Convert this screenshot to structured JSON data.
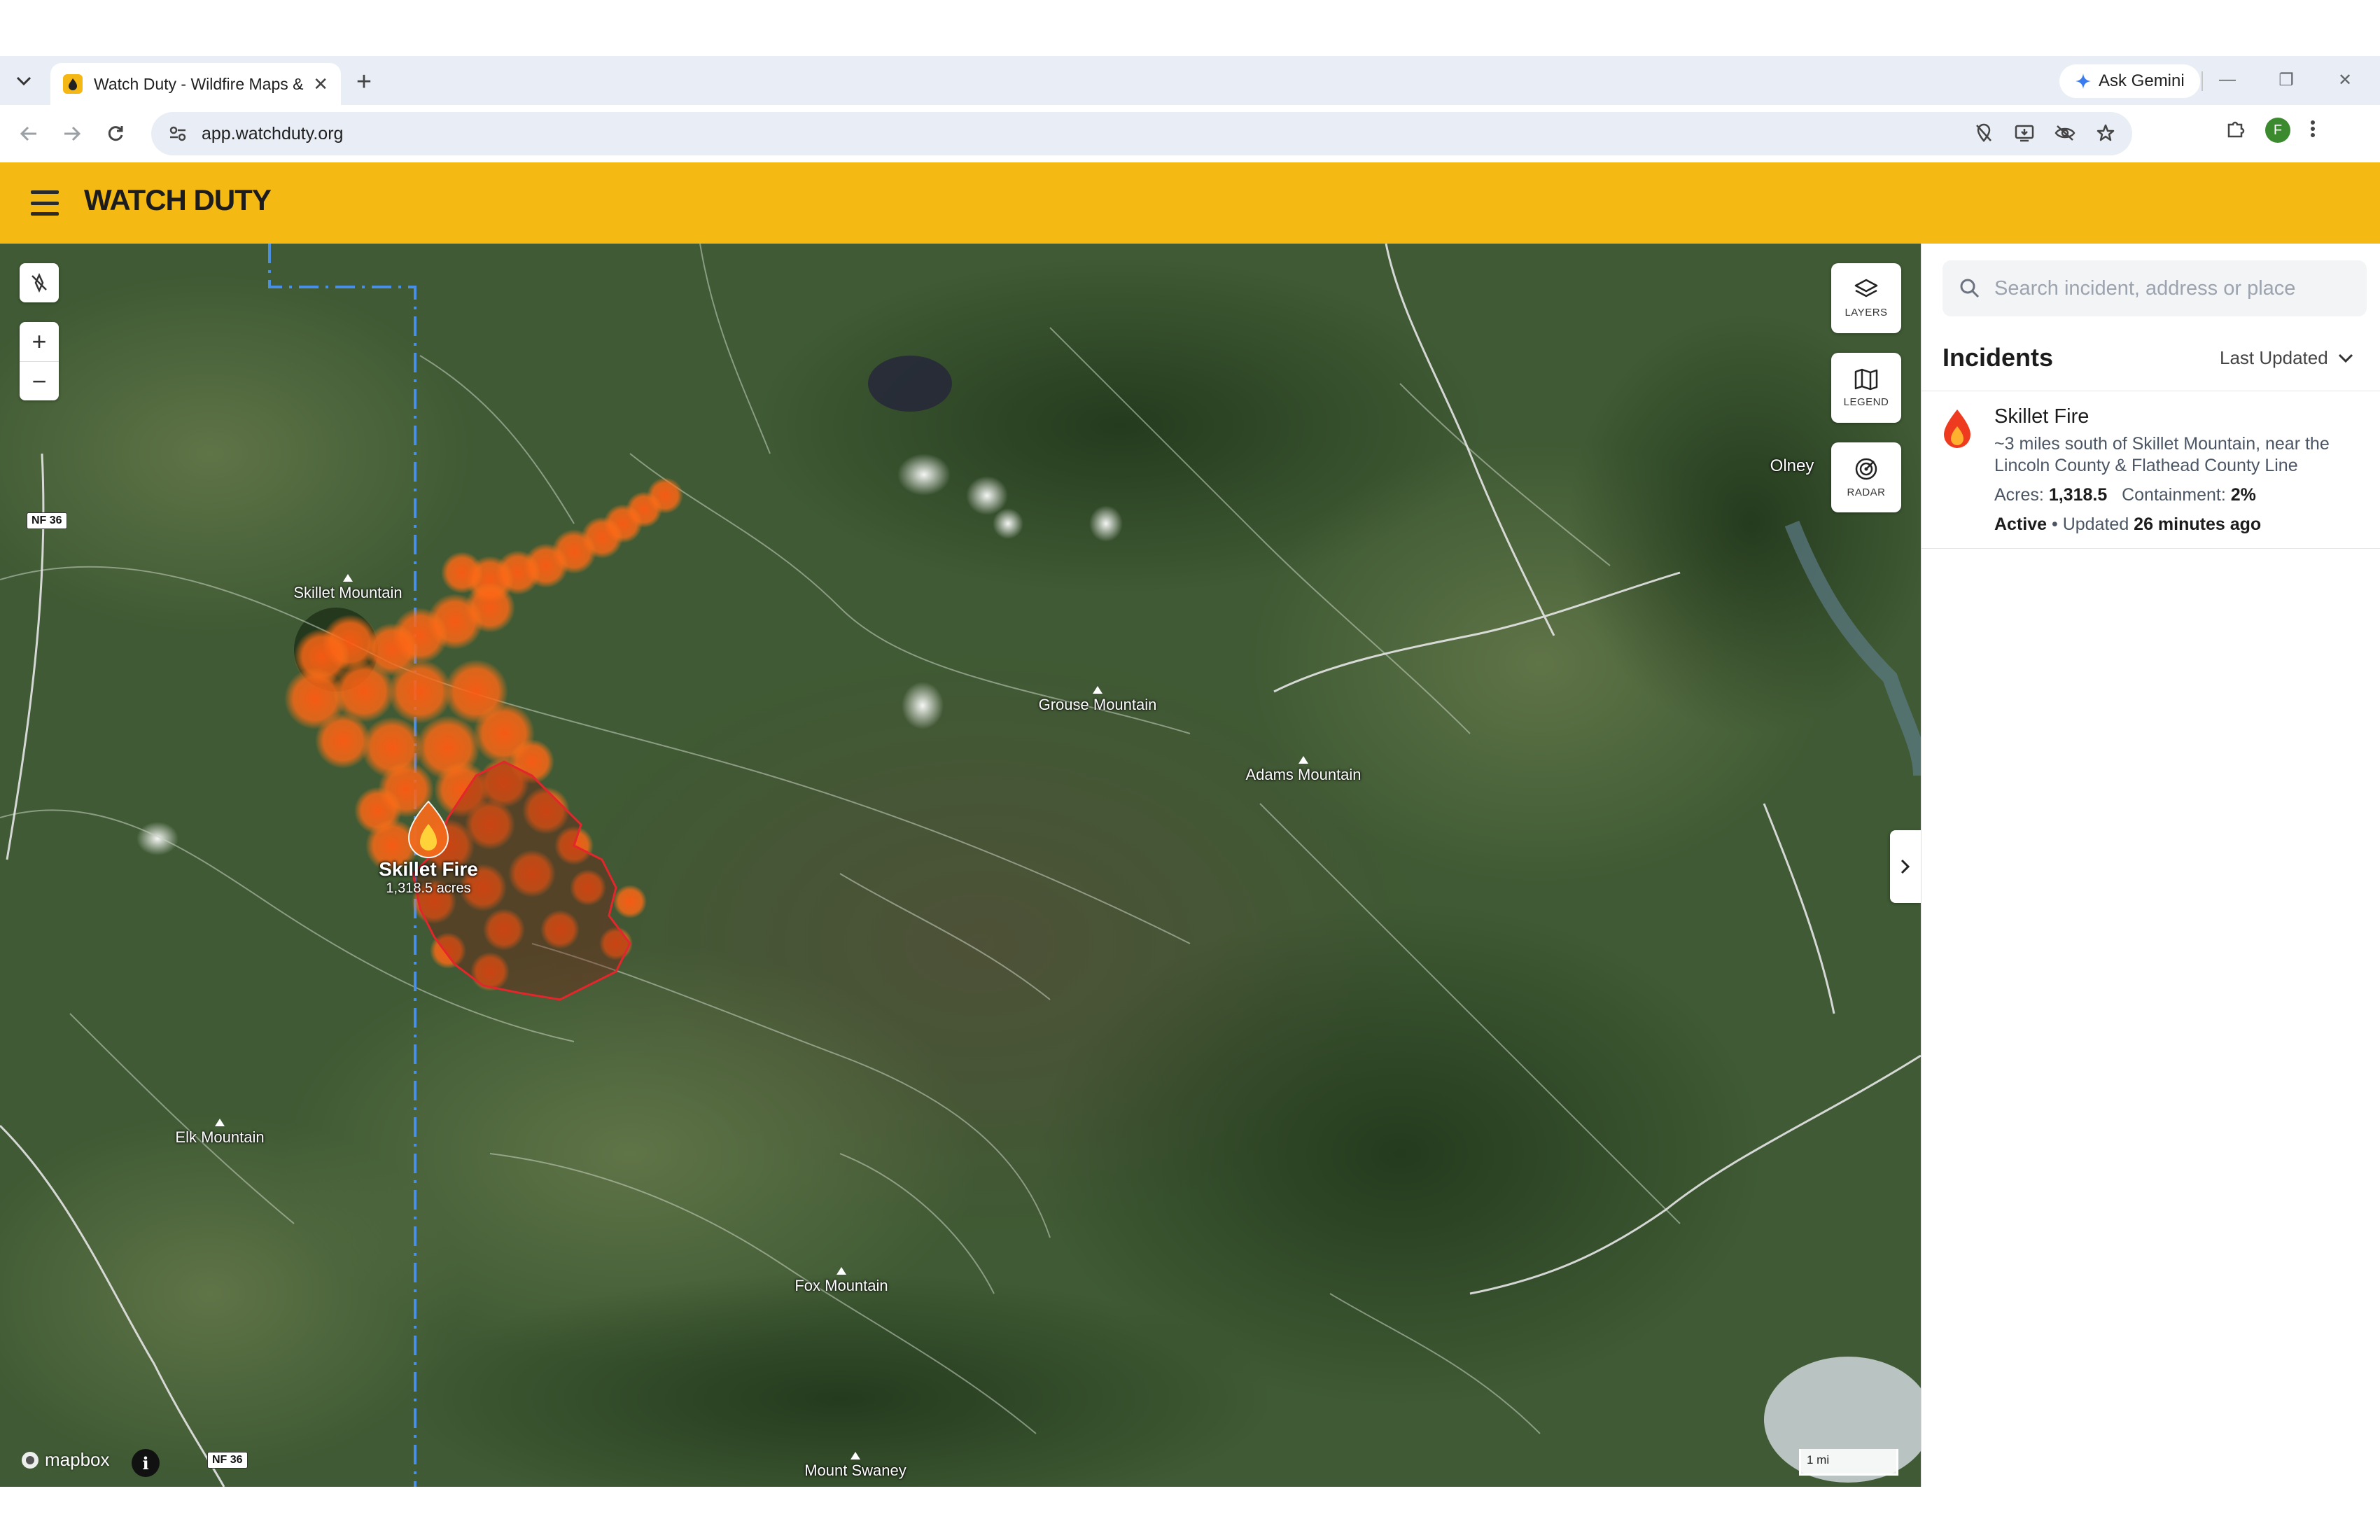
{
  "browser": {
    "tab_title": "Watch Duty - Wildfire Maps & A",
    "url": "app.watchduty.org",
    "gemini_label": "Ask Gemini",
    "profile_initial": "F"
  },
  "app": {
    "brand": "WATCH DUTY",
    "accent_color": "#f4b912"
  },
  "map": {
    "labels": {
      "skillet_mountain": "Skillet Mountain",
      "grouse_mountain": "Grouse Mountain",
      "adams_mountain": "Adams Mountain",
      "elk_mountain": "Elk Mountain",
      "fox_mountain": "Fox Mountain",
      "mount_swaney": "Mount Swaney",
      "olney": "Olney"
    },
    "road_shields": [
      "NF 36",
      "NF 36"
    ],
    "fire": {
      "name": "Skillet Fire",
      "acres_label": "1,318.5 acres"
    },
    "controls": {
      "zoom_in": "+",
      "zoom_out": "−",
      "layers": "LAYERS",
      "legend": "LEGEND",
      "radar": "RADAR"
    },
    "attribution": "mapbox",
    "info": "i",
    "scale": "1 mi"
  },
  "sidebar": {
    "search_placeholder": "Search incident, address or place",
    "incidents_title": "Incidents",
    "sort_label": "Last Updated",
    "incidents": [
      {
        "name": "Skillet Fire",
        "description": "~3 miles south of Skillet Mountain, near the Lincoln County & Flathead County Line",
        "acres_label": "Acres:",
        "acres": "1,318.5",
        "containment_label": "Containment:",
        "containment": "2%",
        "status": "Active",
        "updated_prefix": "• Updated",
        "updated": "26 minutes ago"
      }
    ]
  }
}
